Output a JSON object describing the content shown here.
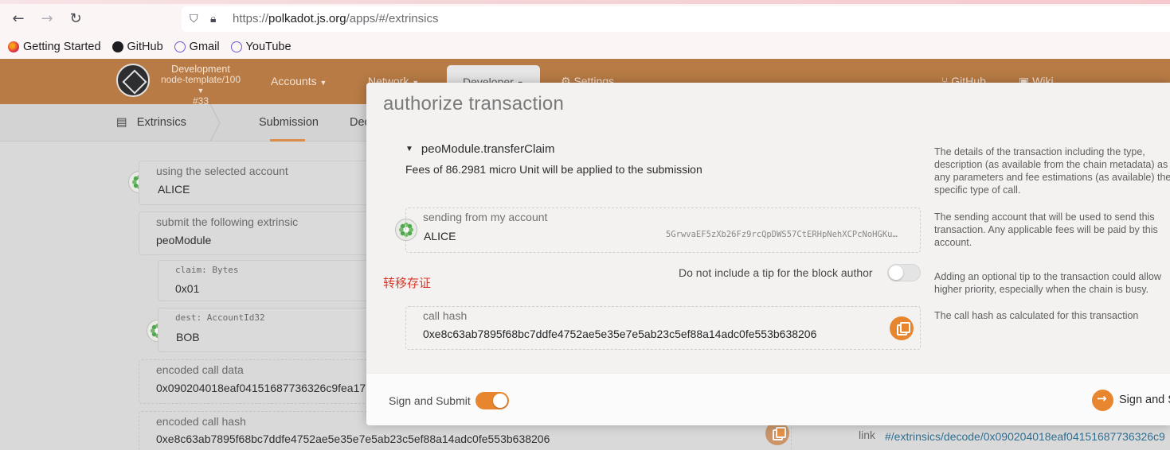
{
  "browser": {
    "url_prefix": "https://",
    "url_host": "polkadot.js.org",
    "url_path": "/apps/#/extrinsics",
    "bookmarks": [
      "Getting Started",
      "GitHub",
      "Gmail",
      "YouTube"
    ]
  },
  "app": {
    "chain": {
      "network": "Development",
      "node": "node-template/100",
      "block": "#33"
    },
    "menu": {
      "accounts": "Accounts",
      "network": "Network",
      "developer": "Developer",
      "settings": "Settings",
      "github": "GitHub",
      "wiki": "Wiki"
    },
    "subnav": {
      "section": "Extrinsics",
      "submission": "Submission",
      "decode": "Dec"
    }
  },
  "page": {
    "selected_account_label": "using the selected account",
    "selected_account_value": "ALICE",
    "extrinsic_label": "submit the following extrinsic",
    "extrinsic_value": "peoModule",
    "param_claim_label": "claim: Bytes",
    "param_claim_value": "0x01",
    "param_dest_label": "dest: AccountId32",
    "param_dest_value": "BOB",
    "encoded_call_data_label": "encoded call data",
    "encoded_call_data_value": "0x090204018eaf04151687736326c9fea17",
    "encoded_call_hash_label": "encoded call hash",
    "encoded_call_hash_value": "0xe8c63ab7895f68bc7ddfe4752ae5e35e7e5ab23c5ef88a14adc0fe553b638206",
    "link_label": "link",
    "link_value": "#/extrinsics/decode/0x090204018eaf04151687736326c9"
  },
  "modal": {
    "title": "authorize transaction",
    "call_name": "peoModule.transferClaim",
    "fees_text": "Fees of 86.2981 micro Unit will be applied to the submission",
    "help_details": "The details of the transaction including the type, description (as available from the chain metadata) as any parameters and fee estimations (as available) the specific type of call.",
    "sending_label": "sending from my account",
    "sending_value": "ALICE",
    "sending_address": "5GrwvaEF5zXb26Fz9rcQpDWS57CtERHpNehXCPcNoHGKu…",
    "help_sending": "The sending account that will be used to send this transaction. Any applicable fees will be paid by this account.",
    "tip_label": "Do not include a tip for the block author",
    "tip_enabled": false,
    "help_tip": "Adding an optional tip to the transaction could allow higher priority, especially when the chain is busy.",
    "note": "转移存证",
    "call_hash_label": "call hash",
    "call_hash_value": "0xe8c63ab7895f68bc7ddfe4752ae5e35e7e5ab23c5ef88a14adc0fe553b638206",
    "help_call_hash": "The call hash as calculated for this transaction",
    "sign_submit_label": "Sign and Submit",
    "sign_submit_enabled": true,
    "sign_button_label": "Sign and Submit"
  },
  "colors": {
    "accent": "#e8862f",
    "header": "#b87b45",
    "note": "#d63a2a"
  }
}
